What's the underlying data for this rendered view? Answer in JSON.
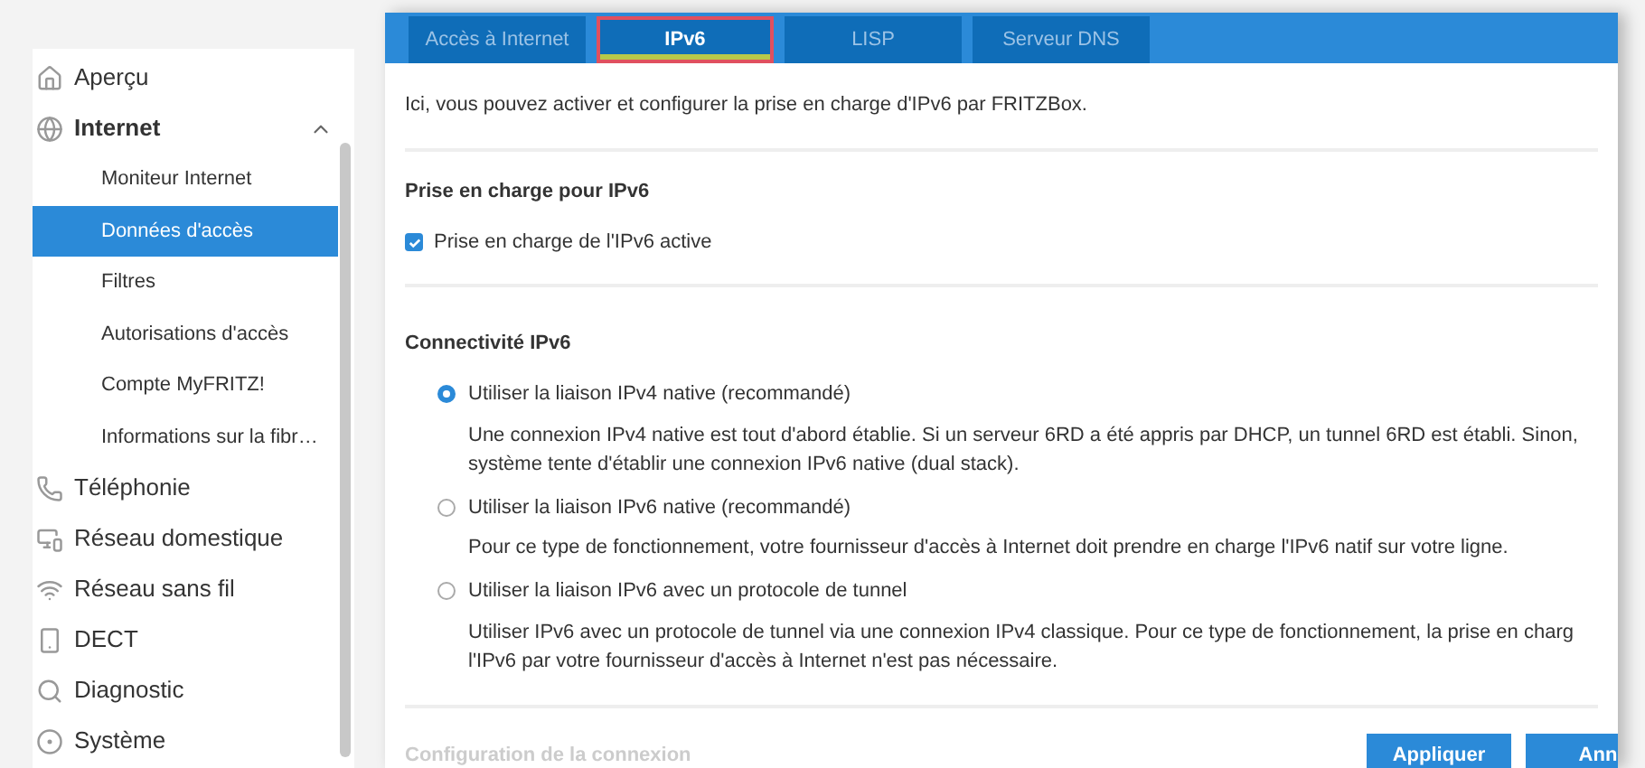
{
  "tabs": [
    {
      "label": "Accès à Internet",
      "selected": false
    },
    {
      "label": "IPv6",
      "selected": true
    },
    {
      "label": "LISP",
      "selected": false
    },
    {
      "label": "Serveur DNS",
      "selected": false
    }
  ],
  "sidebar": {
    "items": [
      {
        "label": "Aperçu"
      },
      {
        "label": "Internet",
        "expanded": true,
        "children": [
          {
            "label": "Moniteur Internet",
            "selected": false
          },
          {
            "label": "Données d'accès",
            "selected": true
          },
          {
            "label": "Filtres",
            "selected": false
          },
          {
            "label": "Autorisations d'accès",
            "selected": false
          },
          {
            "label": "Compte MyFRITZ!",
            "selected": false
          },
          {
            "label": "Informations sur la fibr…",
            "selected": false
          }
        ]
      },
      {
        "label": "Téléphonie"
      },
      {
        "label": "Réseau domestique"
      },
      {
        "label": "Réseau sans fil"
      },
      {
        "label": "DECT"
      },
      {
        "label": "Diagnostic"
      },
      {
        "label": "Système"
      }
    ]
  },
  "intro": "Ici, vous pouvez activer et configurer la prise en charge d'IPv6 par FRITZBox.",
  "support": {
    "title": "Prise en charge pour IPv6",
    "checkbox": {
      "label": "Prise en charge de l'IPv6 active",
      "checked": true
    }
  },
  "connectivity": {
    "title": "Connectivité IPv6",
    "options": [
      {
        "label": "Utiliser la liaison IPv4 native (recommandé)",
        "selected": true,
        "description": [
          "Une connexion IPv4 native est tout d'abord établie. Si un serveur 6RD a été appris par DHCP, un tunnel 6RD est établi. Sinon,",
          "système tente d'établir une connexion IPv6 native (dual stack)."
        ]
      },
      {
        "label": "Utiliser la liaison IPv6 native (recommandé)",
        "selected": false,
        "description": [
          "Pour ce type de fonctionnement, votre fournisseur d'accès à Internet doit prendre en charge l'IPv6 natif sur votre ligne."
        ]
      },
      {
        "label": "Utiliser la liaison IPv6 avec un protocole de tunnel",
        "selected": false,
        "description": [
          "Utiliser IPv6 avec un protocole de tunnel via une connexion IPv4 classique. Pour ce type de fonctionnement, la prise en charg",
          "l'IPv6 par votre fournisseur d'accès à Internet n'est pas nécessaire."
        ]
      }
    ]
  },
  "faded_section": {
    "title": "Configuration de la connexion"
  },
  "buttons": [
    "Appliquer",
    "Ann"
  ]
}
